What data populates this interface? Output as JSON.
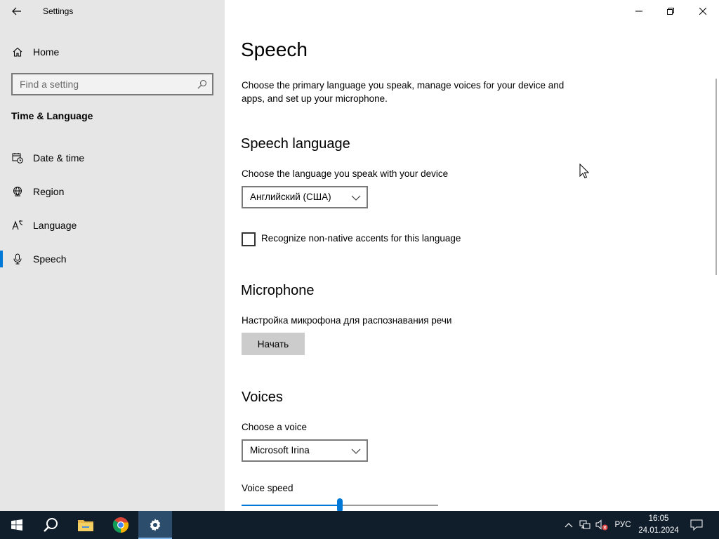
{
  "window": {
    "title": "Settings"
  },
  "sidebar": {
    "home_label": "Home",
    "search_placeholder": "Find a setting",
    "section_title": "Time & Language",
    "items": [
      {
        "label": "Date & time",
        "icon": "calendar-clock-icon"
      },
      {
        "label": "Region",
        "icon": "globe-icon"
      },
      {
        "label": "Language",
        "icon": "language-icon"
      },
      {
        "label": "Speech",
        "icon": "microphone-icon",
        "active": true
      }
    ]
  },
  "main": {
    "title": "Speech",
    "description": "Choose the primary language you speak, manage voices for your device and apps, and set up your microphone.",
    "speech_language": {
      "heading": "Speech language",
      "label": "Choose the language you speak with your device",
      "selected": "Английский (США)",
      "accents_checkbox_label": "Recognize non-native accents for this language",
      "accents_checked": false
    },
    "microphone": {
      "heading": "Microphone",
      "label": "Настройка микрофона для распознавания речи",
      "button_label": "Начать"
    },
    "voices": {
      "heading": "Voices",
      "label": "Choose a voice",
      "selected": "Microsoft Irina",
      "speed_label": "Voice speed",
      "speed_fraction": 0.5
    }
  },
  "taskbar": {
    "language": "РУС",
    "time": "16:05",
    "date": "24.01.2024"
  },
  "colors": {
    "accent": "#0078d7",
    "sidebar_bg": "#e6e6e6",
    "taskbar_bg": "#101e2c"
  }
}
